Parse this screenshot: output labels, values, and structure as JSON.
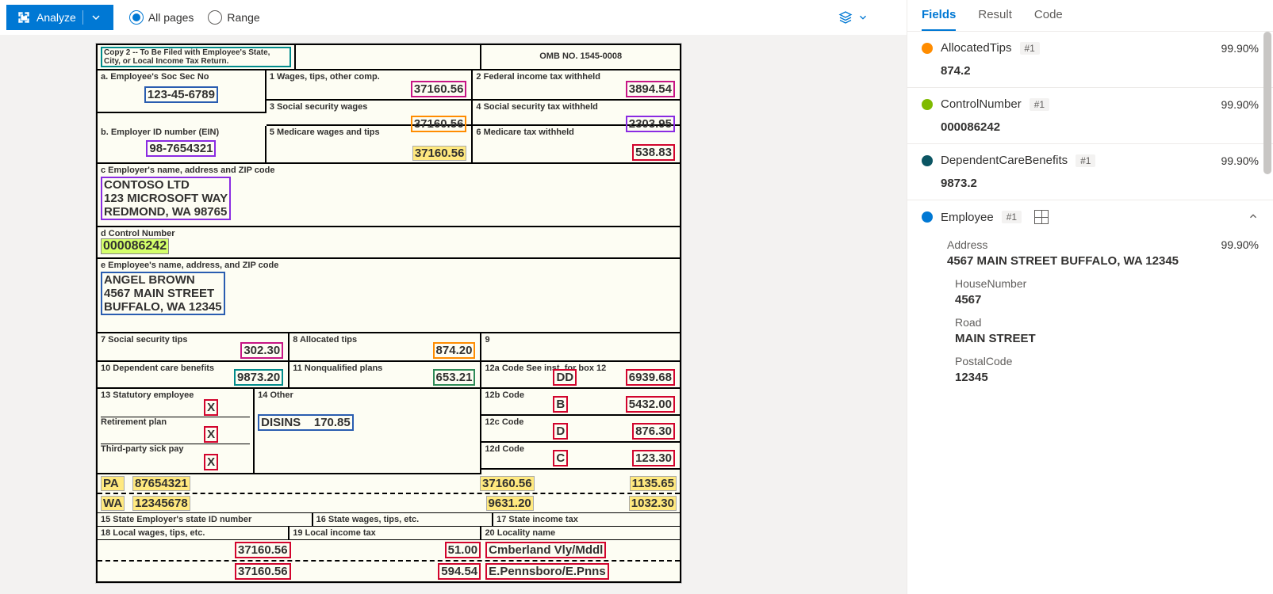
{
  "toolbar": {
    "analyze_label": "Analyze",
    "all_pages": "All pages",
    "range": "Range"
  },
  "tabs": {
    "fields": "Fields",
    "result": "Result",
    "code": "Code"
  },
  "fields": [
    {
      "name": "AllocatedTips",
      "badge": "#1",
      "conf": "99.90%",
      "value": "874.2",
      "color": "#ff8c00"
    },
    {
      "name": "ControlNumber",
      "badge": "#1",
      "conf": "99.90%",
      "value": "000086242",
      "color": "#7fba00"
    },
    {
      "name": "DependentCareBenefits",
      "badge": "#1",
      "conf": "99.90%",
      "value": "9873.2",
      "color": "#0b5563"
    },
    {
      "name": "Employee",
      "badge": "#1",
      "color": "#0078d4",
      "expandable": true
    }
  ],
  "employee_sub": {
    "address_label": "Address",
    "address_conf": "99.90%",
    "address_value": "4567 MAIN STREET BUFFALO, WA 12345",
    "house_label": "HouseNumber",
    "house_value": "4567",
    "road_label": "Road",
    "road_value": "MAIN STREET",
    "postal_label": "PostalCode",
    "postal_value": "12345"
  },
  "w2": {
    "copy2": "Copy 2 -- To Be Filed with Employee's State, City, or Local Income Tax Return.",
    "omb": "OMB NO. 1545-0008",
    "a_label": "a. Employee's Soc Sec No",
    "a_val": "123-45-6789",
    "b_label": "b. Employer ID number (EIN)",
    "b_val": "98-7654321",
    "box1_label": "1 Wages, tips, other comp.",
    "box1_val": "37160.56",
    "box2_label": "2 Federal income tax withheld",
    "box2_val": "3894.54",
    "box3_label": "3 Social security wages",
    "box3_val": "37160.56",
    "box4_label": "4 Social security tax withheld",
    "box4_val": "2303.95",
    "box5_label": "5 Medicare wages and tips",
    "box5_val": "37160.56",
    "box6_label": "6 Medicare tax withheld",
    "box6_val": "538.83",
    "c_label": "c Employer's name, address and ZIP code",
    "c_l1": "CONTOSO LTD",
    "c_l2": "123 MICROSOFT WAY",
    "c_l3": "REDMOND, WA 98765",
    "d_label": "d Control Number",
    "d_val": "000086242",
    "e_label": "e Employee's name, address, and ZIP code",
    "e_l1": "ANGEL BROWN",
    "e_l2": "4567 MAIN STREET",
    "e_l3": "BUFFALO, WA 12345",
    "box7_label": "7 Social security tips",
    "box7_val": "302.30",
    "box8_label": "8 Allocated tips",
    "box8_val": "874.20",
    "box9_label": "9",
    "box10_label": "10 Dependent care benefits",
    "box10_val": "9873.20",
    "box11_label": "11 Nonqualified plans",
    "box11_val": "653.21",
    "box12a_label": "12a Code See inst. for box 12",
    "box12a_code": "DD",
    "box12a_val": "6939.68",
    "box12b_label": "12b Code",
    "box12b_code": "B",
    "box12b_val": "5432.00",
    "box12c_label": "12c Code",
    "box12c_code": "D",
    "box12c_val": "876.30",
    "box12d_label": "12d Code",
    "box12d_code": "C",
    "box12d_val": "123.30",
    "box13_label": "13 Statutory employee",
    "box13_ret": "Retirement plan",
    "box13_sick": "Third-party sick pay",
    "box14_label": "14 Other",
    "box14_val": "DISINS    170.85",
    "state1": "PA",
    "stateid1": "87654321",
    "swages1": "37160.56",
    "stax1": "1135.65",
    "state2": "WA",
    "stateid2": "12345678",
    "swages2": "9631.20",
    "stax2": "1032.30",
    "box15_label": "15 State Employer's state ID number",
    "box16_label": "16 State wages, tips, etc.",
    "box17_label": "17 State income tax",
    "box18_label": "18 Local wages, tips, etc.",
    "box19_label": "19 Local income tax",
    "box20_label": "20 Locality name",
    "lwages1": "37160.56",
    "ltax1": "51.00",
    "lname1": "Cmberland Vly/Mddl",
    "lwages2": "37160.56",
    "ltax2": "594.54",
    "lname2": "E.Pennsboro/E.Pnns",
    "x": "X"
  }
}
